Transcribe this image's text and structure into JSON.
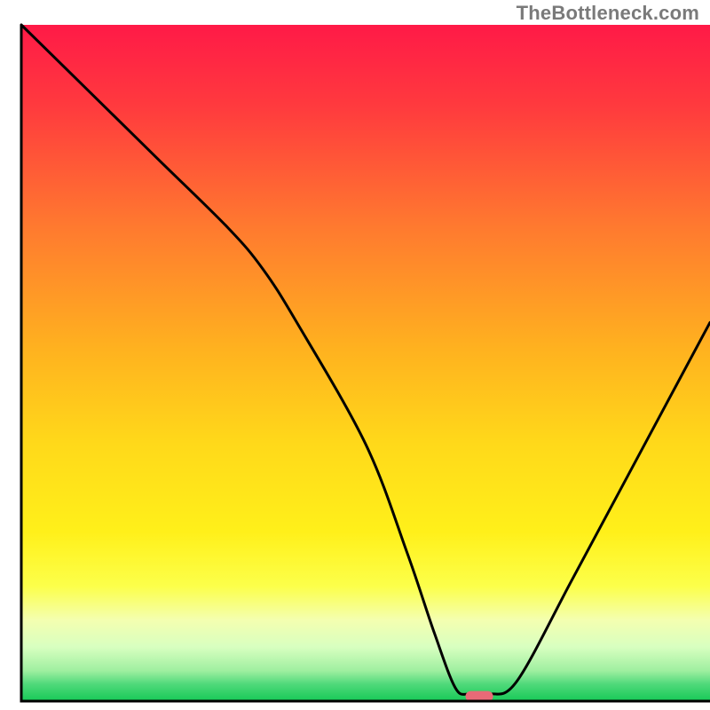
{
  "watermark": "TheBottleneck.com",
  "chart_data": {
    "type": "line",
    "title": "",
    "xlabel": "",
    "ylabel": "",
    "xlim": [
      0,
      100
    ],
    "ylim": [
      0,
      100
    ],
    "series": [
      {
        "name": "bottleneck-curve",
        "x": [
          0,
          10,
          20,
          30,
          35,
          40,
          50,
          56,
          60,
          63,
          65,
          68,
          72,
          80,
          90,
          100
        ],
        "y": [
          100,
          90,
          80,
          70,
          64,
          56,
          38,
          22,
          10,
          2,
          1,
          1,
          3,
          18,
          37,
          56
        ]
      }
    ],
    "marker": {
      "name": "sweet-spot",
      "x_center": 66.5,
      "width": 4,
      "y": 0.7,
      "color": "#e86a77"
    },
    "gradient_stops": [
      {
        "offset": 0.0,
        "color": "#ff1a47"
      },
      {
        "offset": 0.12,
        "color": "#ff3a3e"
      },
      {
        "offset": 0.3,
        "color": "#ff7a2f"
      },
      {
        "offset": 0.48,
        "color": "#ffb21f"
      },
      {
        "offset": 0.62,
        "color": "#ffd91a"
      },
      {
        "offset": 0.75,
        "color": "#fff01a"
      },
      {
        "offset": 0.83,
        "color": "#fcff4a"
      },
      {
        "offset": 0.88,
        "color": "#f4ffb0"
      },
      {
        "offset": 0.92,
        "color": "#d8ffc0"
      },
      {
        "offset": 0.955,
        "color": "#9fefa0"
      },
      {
        "offset": 0.975,
        "color": "#4fd97a"
      },
      {
        "offset": 1.0,
        "color": "#17c957"
      }
    ],
    "axis": {
      "color": "#000000",
      "width": 3
    }
  }
}
